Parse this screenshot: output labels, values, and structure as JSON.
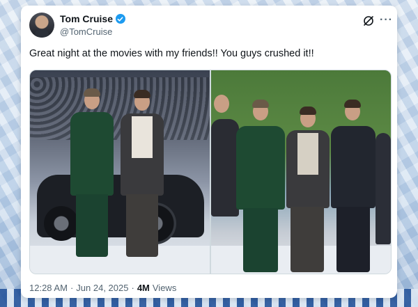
{
  "author": {
    "display_name": "Tom Cruise",
    "handle": "@TomCruise",
    "verified": true
  },
  "header_actions": {
    "grok_icon": "grok-icon",
    "more_icon": "more-icon",
    "more_glyph": "···"
  },
  "tweet": {
    "text": "Great night at the movies with my friends!! You guys crushed it!!"
  },
  "media": {
    "count": 2
  },
  "meta": {
    "time": "12:28 AM",
    "separator": "·",
    "date": "Jun 24, 2025",
    "views_count": "4M",
    "views_label": "Views"
  },
  "colors": {
    "verified": "#1d9bf0",
    "text_primary": "#0f1419",
    "text_secondary": "#536471"
  }
}
